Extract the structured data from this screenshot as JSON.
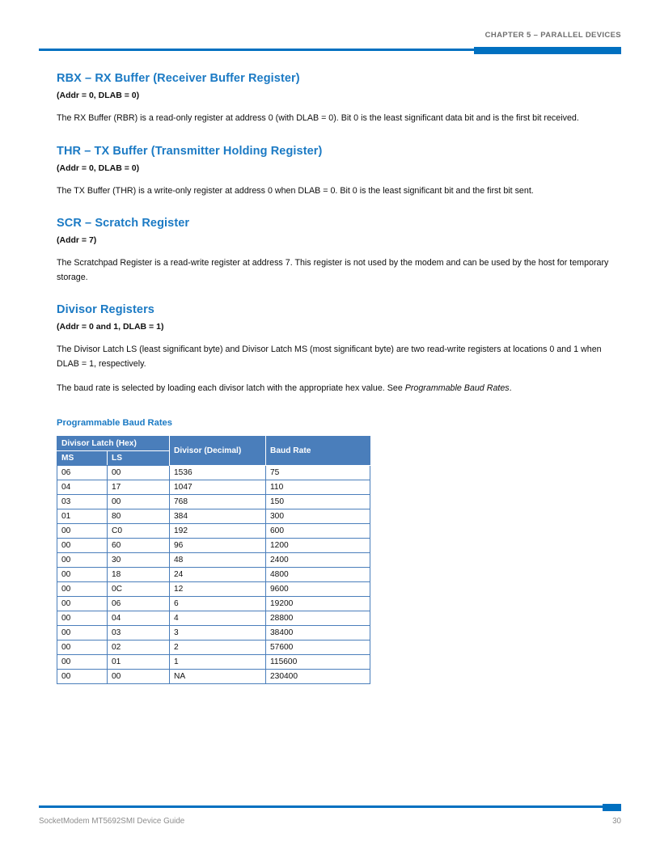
{
  "header": {
    "chapter_label": "CHAPTER 5 – PARALLEL DEVICES",
    "rule_color": "#0070c0",
    "text_color": "#6e6e6e"
  },
  "theme": {
    "heading_blue": "#1b7ac4",
    "table_header_blue": "#4a7ebb",
    "table_border_blue": "#4a7ebb",
    "rule_blue": "#0070c0",
    "footer_gray": "#8d8d8d"
  },
  "sections": [
    {
      "heading": "RBX – RX Buffer (Receiver Buffer Register)",
      "addr": "(Addr = 0, DLAB = 0)",
      "body": "The RX Buffer (RBR) is a read-only register at address 0 (with DLAB = 0). Bit 0 is the least significant data bit and is the first bit received."
    },
    {
      "heading": "THR – TX Buffer (Transmitter Holding Register)",
      "addr": "(Addr = 0, DLAB = 0)",
      "body": "The TX Buffer (THR) is a write-only register at address 0 when DLAB = 0. Bit 0 is the least significant bit and the first bit sent."
    },
    {
      "heading": "SCR – Scratch Register",
      "addr": "(Addr = 7)",
      "body": "The Scratchpad Register is a read-write register at address 7. This register is not used by the modem and can be used by the host for temporary storage."
    },
    {
      "heading": "Divisor Registers",
      "addr": "(Addr = 0 and 1, DLAB = 1)",
      "body": "The Divisor Latch LS (least significant byte) and Divisor Latch MS (most significant byte) are two read-write registers at locations 0 and 1 when DLAB = 1, respectively.",
      "body2_prefix": "The baud rate is selected by loading each divisor latch with the appropriate hex value. See ",
      "body2_italic": "Programmable Baud Rates",
      "body2_suffix": "."
    }
  ],
  "table": {
    "caption": "Programmable Baud Rates",
    "group_header": "Divisor Latch (Hex)",
    "columns": {
      "ms": "MS",
      "ls": "LS",
      "decimal": "Divisor (Decimal)",
      "baud": "Baud Rate"
    },
    "rows": [
      {
        "ms": "06",
        "ls": "00",
        "decimal": "1536",
        "baud": "75"
      },
      {
        "ms": "04",
        "ls": "17",
        "decimal": "1047",
        "baud": "110"
      },
      {
        "ms": "03",
        "ls": "00",
        "decimal": "768",
        "baud": "150"
      },
      {
        "ms": "01",
        "ls": "80",
        "decimal": "384",
        "baud": "300"
      },
      {
        "ms": "00",
        "ls": "C0",
        "decimal": "192",
        "baud": "600"
      },
      {
        "ms": "00",
        "ls": "60",
        "decimal": "96",
        "baud": "1200"
      },
      {
        "ms": "00",
        "ls": "30",
        "decimal": "48",
        "baud": "2400"
      },
      {
        "ms": "00",
        "ls": "18",
        "decimal": "24",
        "baud": "4800"
      },
      {
        "ms": "00",
        "ls": "0C",
        "decimal": "12",
        "baud": "9600"
      },
      {
        "ms": "00",
        "ls": "06",
        "decimal": "6",
        "baud": "19200"
      },
      {
        "ms": "00",
        "ls": "04",
        "decimal": "4",
        "baud": "28800"
      },
      {
        "ms": "00",
        "ls": "03",
        "decimal": "3",
        "baud": "38400"
      },
      {
        "ms": "00",
        "ls": "02",
        "decimal": "2",
        "baud": "57600"
      },
      {
        "ms": "00",
        "ls": "01",
        "decimal": "1",
        "baud": "115600"
      },
      {
        "ms": "00",
        "ls": "00",
        "decimal": "NA",
        "baud": "230400"
      }
    ]
  },
  "footer": {
    "doc_title": "SocketModem MT5692SMI Device Guide",
    "page_number": "30"
  }
}
